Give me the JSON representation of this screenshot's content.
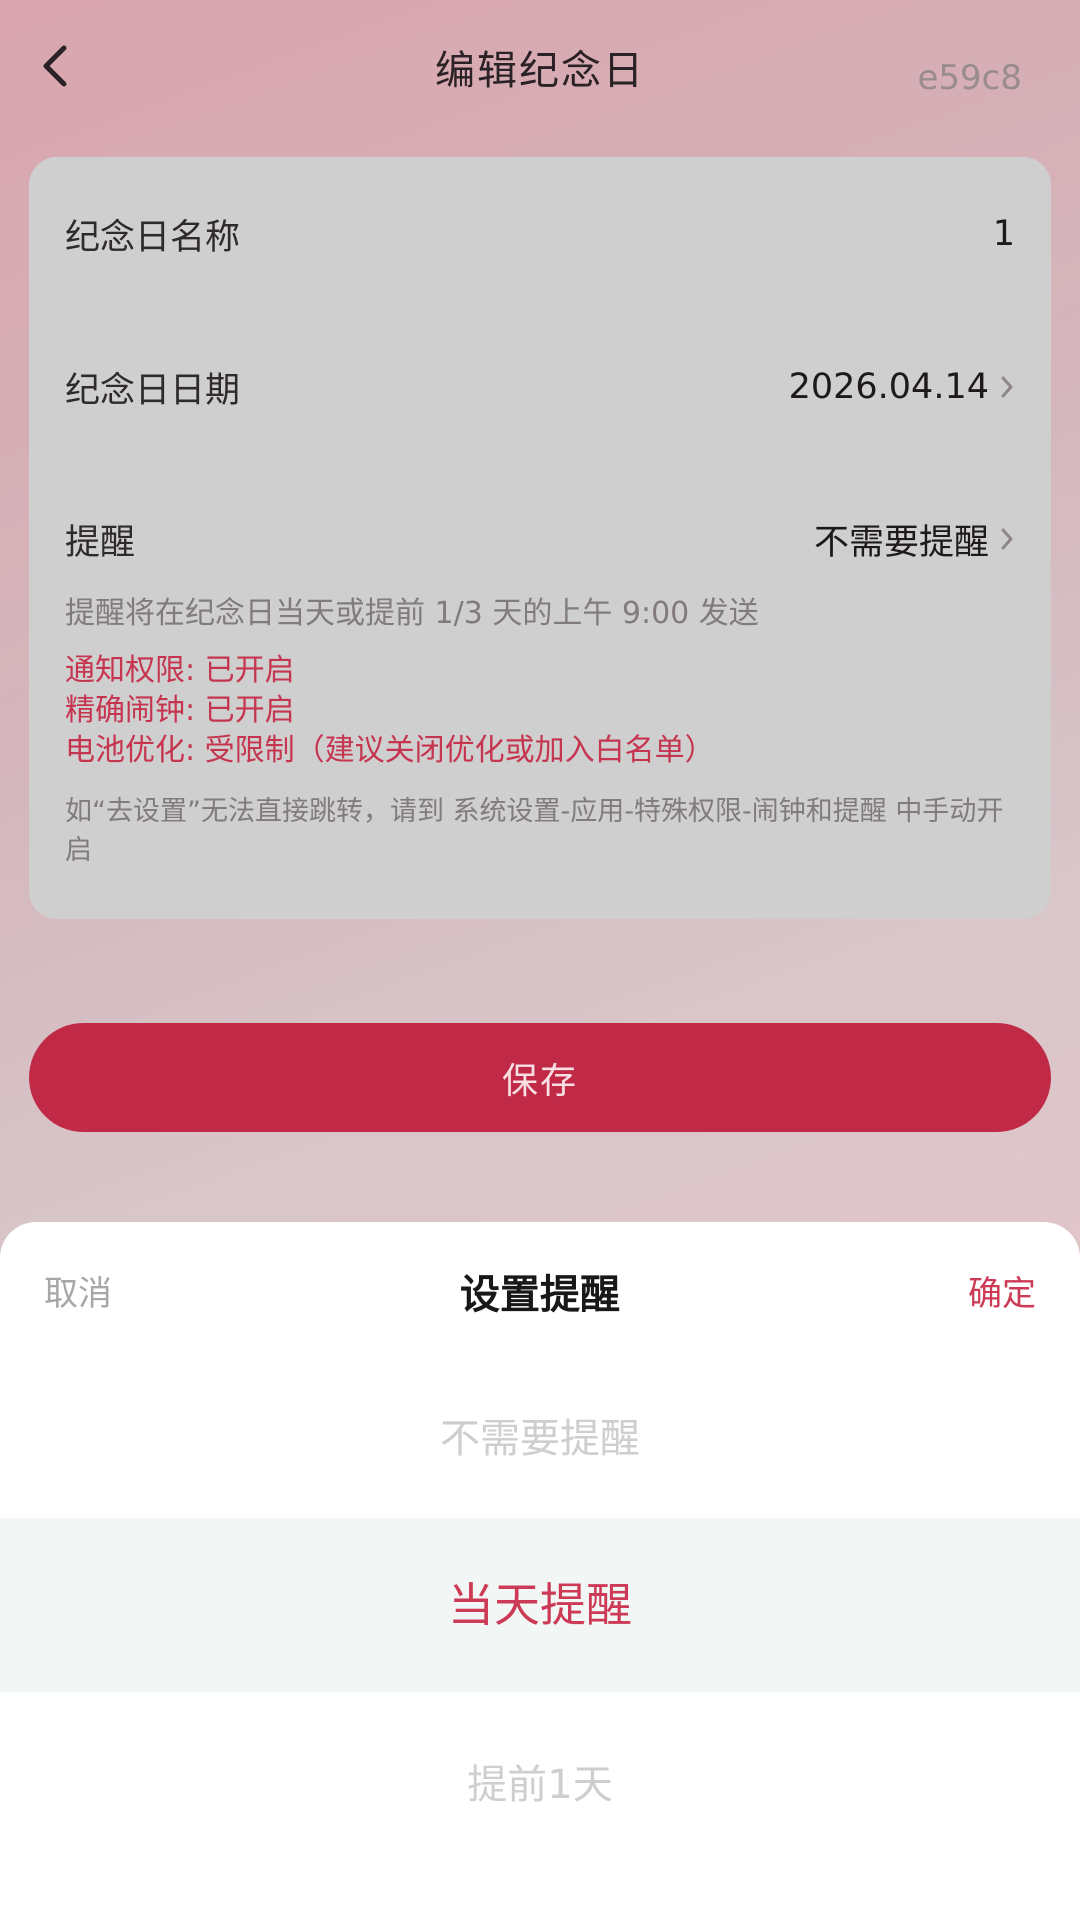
{
  "header": {
    "title": "编辑纪念日",
    "version": "e59c8",
    "back_icon": "chevron-left-icon"
  },
  "card": {
    "name_label": "纪念日名称",
    "name_value": "1",
    "date_label": "纪念日日期",
    "date_value": "2026.04.14",
    "reminder_label": "提醒",
    "reminder_value": "不需要提醒",
    "reminder_hint": "提醒将在纪念日当天或提前 1/3 天的上午 9:00 发送",
    "notify_permission": "通知权限: 已开启",
    "exact_alarm": "精确闹钟: 已开启",
    "battery_optimization": "电池优化: 受限制（建议关闭优化或加入白名单）",
    "settings_note": "如“去设置”无法直接跳转，请到 系统设置-应用-特殊权限-闹钟和提醒 中手动开启"
  },
  "save_label": "保存",
  "sheet": {
    "cancel_label": "取消",
    "title": "设置提醒",
    "confirm_label": "确定",
    "options": [
      "不需要提醒",
      "当天提醒",
      "提前1天"
    ],
    "selected_index": 1
  },
  "colors": {
    "accent": "#c02a47",
    "accent_text": "#cd3a55",
    "warning_text": "#c5354f"
  }
}
